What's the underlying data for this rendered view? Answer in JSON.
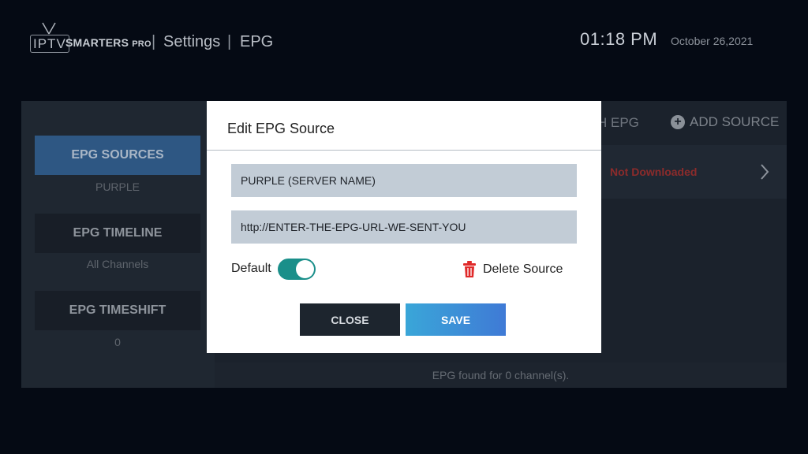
{
  "header": {
    "logo_iptv": "IPTV",
    "logo_smarters": "SMARTERS",
    "logo_pro": "PRO",
    "breadcrumb": [
      "Settings",
      "EPG"
    ],
    "separator": "|",
    "time": "01:18 PM",
    "date": "October 26,2021"
  },
  "sidebar": {
    "items": [
      {
        "label": "EPG SOURCES",
        "sub": "PURPLE",
        "active": true
      },
      {
        "label": "EPG TIMELINE",
        "sub": "All Channels",
        "active": false
      },
      {
        "label": "EPG TIMESHIFT",
        "sub": "0",
        "active": false
      }
    ]
  },
  "toolbar": {
    "refresh_partial": "H EPG",
    "add_source": "ADD SOURCE",
    "add_icon": "plus-circle-icon"
  },
  "source_row": {
    "status": "Not Downloaded",
    "status_color": "#8c2b2b"
  },
  "footer": {
    "text": "EPG found for 0 channel(s)."
  },
  "dialog": {
    "title": "Edit EPG Source",
    "name_value": "PURPLE (SERVER NAME)",
    "url_value": "http://ENTER-THE-EPG-URL-WE-SENT-YOU",
    "default_label": "Default",
    "default_on": true,
    "delete_label": "Delete Source",
    "close_label": "CLOSE",
    "save_label": "SAVE",
    "accent_color": "#1a8f8a",
    "delete_color": "#e02a2a"
  }
}
